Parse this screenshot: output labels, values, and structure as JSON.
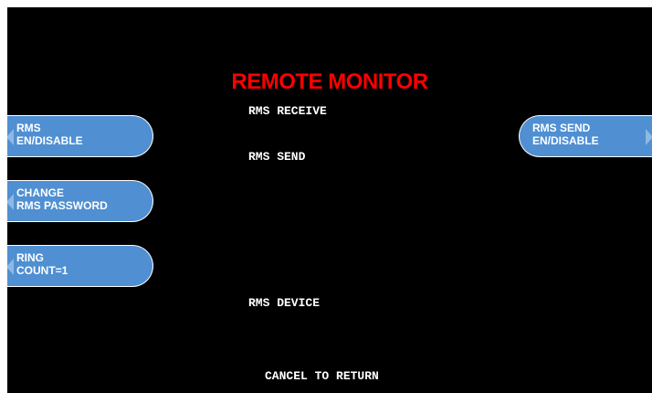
{
  "screen": {
    "title": "REMOTE MONITOR",
    "title_color": "#ff0000",
    "background_color": "#000000",
    "button_color": "#4f8fd2"
  },
  "status": {
    "rms_receive": "RMS RECEIVE",
    "rms_send": "RMS SEND",
    "rms_device": "RMS DEVICE"
  },
  "footer": {
    "cancel": "CANCEL TO RETURN"
  },
  "left_buttons": [
    {
      "line1": "RMS",
      "line2": "EN/DISABLE"
    },
    {
      "line1": "CHANGE",
      "line2": "RMS PASSWORD"
    },
    {
      "line1": "RING",
      "line2": "COUNT=1"
    }
  ],
  "right_buttons": [
    {
      "line1": "RMS SEND",
      "line2": "EN/DISABLE"
    }
  ]
}
